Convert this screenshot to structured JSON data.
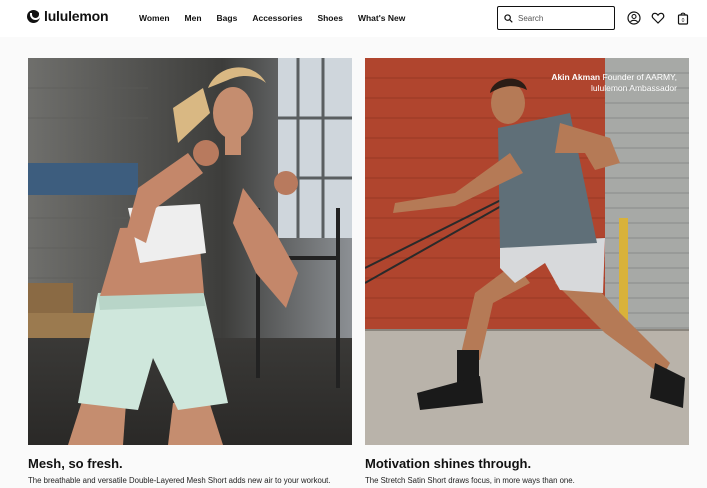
{
  "header": {
    "logo_text": "lululemon",
    "nav": [
      "Women",
      "Men",
      "Bags",
      "Accessories",
      "Shoes",
      "What's New"
    ],
    "search_placeholder": "Search",
    "icons": [
      "account-icon",
      "heart-icon",
      "bag-icon"
    ],
    "bag_count": "0"
  },
  "cards": [
    {
      "title": "Mesh, so fresh.",
      "description": "The breathable and versatile Double-Layered Mesh Short adds new air to your workout."
    },
    {
      "title": "Motivation shines through.",
      "description": "The Stretch Satin Short draws focus, in more ways than one.",
      "caption_name": "Akin Akman",
      "caption_role": "Founder of AARMY,",
      "caption_line2": "lululemon Ambassador"
    }
  ],
  "colors": {
    "accent": "#111111",
    "background": "#fafafa",
    "brick": "#b0452e"
  }
}
